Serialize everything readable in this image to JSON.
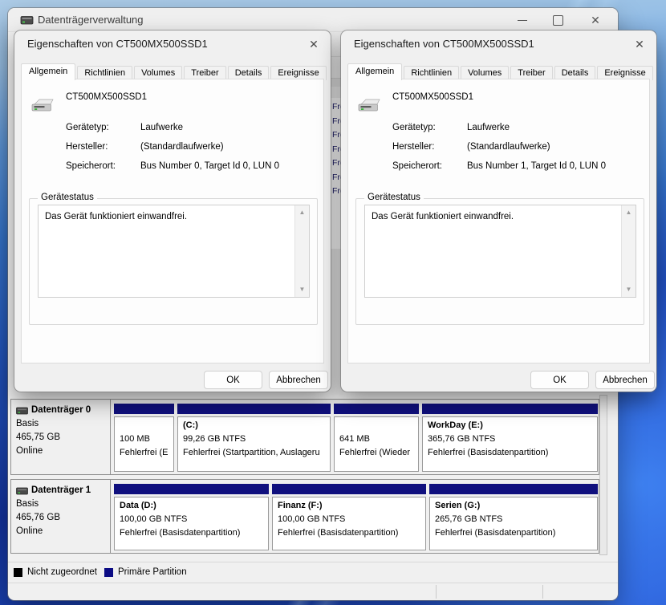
{
  "icons": {
    "app": "disk-drive",
    "close": "✕",
    "dialog_close": "✕",
    "scroll_up": "▲",
    "scroll_down": "▼"
  },
  "colors": {
    "partition_bar": "#10107e",
    "legend_unallocated": "#000000",
    "legend_primary": "#0c0c84"
  },
  "main_window": {
    "title": "Datenträgerverwaltung"
  },
  "background_pane": {
    "list_rows": [
      "Fre",
      "Fre",
      "Fre",
      "Fre",
      "Fre",
      "Fre",
      "Fre"
    ]
  },
  "disk_view": {
    "disks": [
      {
        "name": "Datenträger 0",
        "type": "Basis",
        "size": "465,75 GB",
        "status": "Online",
        "partitions": [
          {
            "title": "",
            "size_line": "100 MB",
            "status_line": "Fehlerfrei (E"
          },
          {
            "title": "(C:)",
            "size_line": "99,26 GB NTFS",
            "status_line": "Fehlerfrei (Startpartition, Auslageru"
          },
          {
            "title": "",
            "size_line": "641 MB",
            "status_line": "Fehlerfrei (Wieder"
          },
          {
            "title": "WorkDay  (E:)",
            "size_line": "365,76 GB NTFS",
            "status_line": "Fehlerfrei (Basisdatenpartition)"
          }
        ]
      },
      {
        "name": "Datenträger 1",
        "type": "Basis",
        "size": "465,76 GB",
        "status": "Online",
        "partitions": [
          {
            "title": "Data  (D:)",
            "size_line": "100,00 GB NTFS",
            "status_line": "Fehlerfrei (Basisdatenpartition)"
          },
          {
            "title": "Finanz  (F:)",
            "size_line": "100,00 GB NTFS",
            "status_line": "Fehlerfrei (Basisdatenpartition)"
          },
          {
            "title": "Serien  (G:)",
            "size_line": "265,76 GB NTFS",
            "status_line": "Fehlerfrei (Basisdatenpartition)"
          }
        ]
      }
    ],
    "legend": [
      {
        "label": "Nicht zugeordnet",
        "color": "#000000"
      },
      {
        "label": "Primäre Partition",
        "color": "#0c0c84"
      }
    ]
  },
  "dialogs": [
    {
      "title": "Eigenschaften von CT500MX500SSD1",
      "tabs": [
        "Allgemein",
        "Richtlinien",
        "Volumes",
        "Treiber",
        "Details",
        "Ereignisse"
      ],
      "active_tab": "Allgemein",
      "device_name": "CT500MX500SSD1",
      "fields": [
        {
          "label": "Gerätetyp:",
          "value": "Laufwerke"
        },
        {
          "label": "Hersteller:",
          "value": "(Standardlaufwerke)"
        },
        {
          "label": "Speicherort:",
          "value": "Bus Number 0, Target Id 0, LUN 0"
        }
      ],
      "group_label": "Gerätestatus",
      "status_text": "Das Gerät funktioniert einwandfrei.",
      "buttons": {
        "ok": "OK",
        "cancel": "Abbrechen"
      }
    },
    {
      "title": "Eigenschaften von CT500MX500SSD1",
      "tabs": [
        "Allgemein",
        "Richtlinien",
        "Volumes",
        "Treiber",
        "Details",
        "Ereignisse"
      ],
      "active_tab": "Allgemein",
      "device_name": "CT500MX500SSD1",
      "fields": [
        {
          "label": "Gerätetyp:",
          "value": "Laufwerke"
        },
        {
          "label": "Hersteller:",
          "value": "(Standardlaufwerke)"
        },
        {
          "label": "Speicherort:",
          "value": "Bus Number 1, Target Id 0, LUN 0"
        }
      ],
      "group_label": "Gerätestatus",
      "status_text": "Das Gerät funktioniert einwandfrei.",
      "buttons": {
        "ok": "OK",
        "cancel": "Abbrechen"
      }
    }
  ]
}
